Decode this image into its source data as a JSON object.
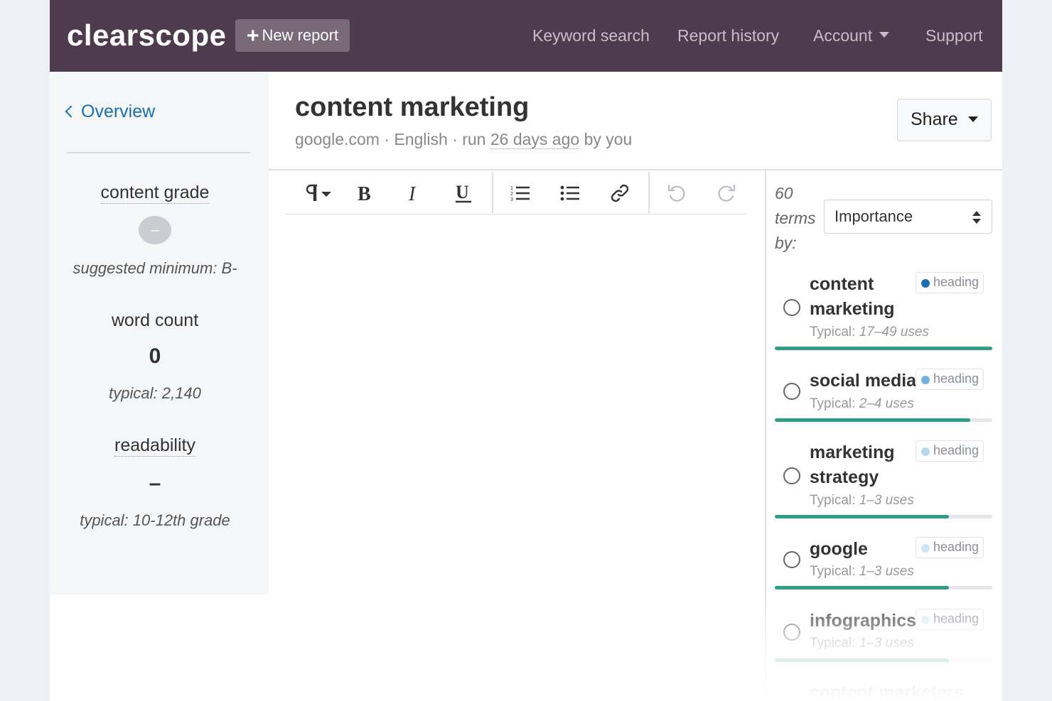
{
  "nav": {
    "brand": "clearscope",
    "new_report_label": "New report",
    "links": [
      {
        "label": "Keyword search"
      },
      {
        "label": "Report history"
      },
      {
        "label": "Account"
      },
      {
        "label": "Support"
      }
    ]
  },
  "sidebar": {
    "back_label": "Overview",
    "content_grade": {
      "label": "content grade",
      "value": "–",
      "suggested": "suggested minimum: B-"
    },
    "word_count": {
      "label": "word count",
      "value": "0",
      "typical": "typical: 2,140"
    },
    "readability": {
      "label": "readability",
      "value": "–",
      "typical": "typical: 10-12th grade"
    }
  },
  "report": {
    "title": "content marketing",
    "meta_prefix": "google.com · English · run ",
    "meta_when": "26 days ago",
    "meta_suffix": " by you",
    "share_label": "Share"
  },
  "toolbar": {
    "icons": [
      "paragraph-icon",
      "bold-icon",
      "italic-icon",
      "underline-icon",
      "ordered-list-icon",
      "bullet-list-icon",
      "link-icon",
      "undo-icon",
      "redo-icon"
    ]
  },
  "terms_panel": {
    "count_label_line1": "60",
    "count_label_line2": "terms",
    "count_label_line3": "by:",
    "sort_value": "Importance",
    "terms": [
      {
        "name": "content marketing",
        "badge": "heading",
        "typical_prefix": "Typical: ",
        "typical_range": "17–49 uses",
        "progress": 1.0,
        "dot_color": "#1a6fb0"
      },
      {
        "name": "social media",
        "badge": "heading",
        "typical_prefix": "Typical: ",
        "typical_range": "2–4 uses",
        "progress": 0.9,
        "dot_color": "#6fb3e0"
      },
      {
        "name": "marketing strategy",
        "badge": "heading",
        "typical_prefix": "Typical: ",
        "typical_range": "1–3 uses",
        "progress": 0.8,
        "dot_color": "#b5d8f0"
      },
      {
        "name": "google",
        "badge": "heading",
        "typical_prefix": "Typical: ",
        "typical_range": "1–3 uses",
        "progress": 0.8,
        "dot_color": "#cfe5f5"
      },
      {
        "name": "infographics",
        "badge": "heading",
        "typical_prefix": "Typical: ",
        "typical_range": "1–3 uses",
        "progress": 0.8,
        "dot_color": "#d8ebf7"
      }
    ],
    "partial_term": "content marketers"
  },
  "colors": {
    "navbar": "#4f3b4e",
    "accent_link": "#1a6fb0",
    "progress": "#2e9e84"
  }
}
